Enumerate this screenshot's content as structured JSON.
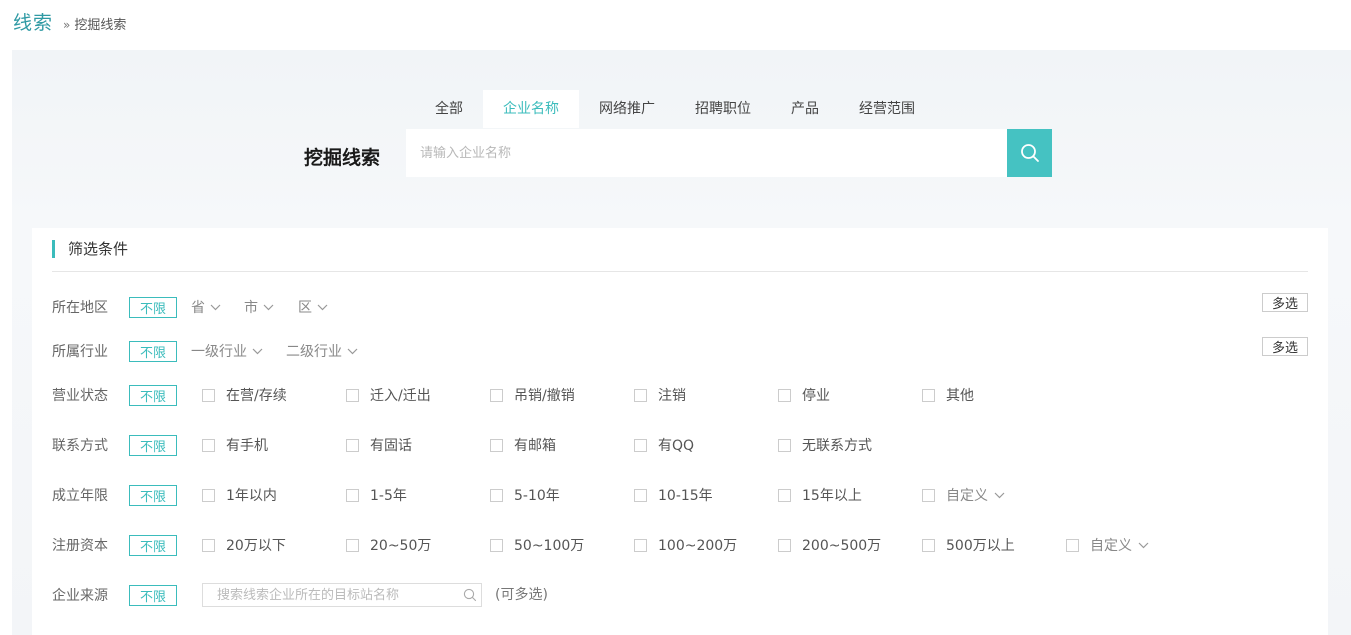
{
  "breadcrumb": {
    "root": "线索",
    "separator": "»",
    "current": "挖掘线索"
  },
  "search": {
    "tabs": [
      "全部",
      "企业名称",
      "网络推广",
      "招聘职位",
      "产品",
      "经营范围"
    ],
    "active_tab_index": 1,
    "label": "挖掘线索",
    "placeholder": "请输入企业名称",
    "value": "",
    "button_icon": "search-icon"
  },
  "filters": {
    "title": "筛选条件",
    "unlimited_label": "不限",
    "multi_select_label": "多选",
    "region": {
      "label": "所在地区",
      "dropdowns": [
        "省",
        "市",
        "区"
      ]
    },
    "industry": {
      "label": "所属行业",
      "dropdowns": [
        "一级行业",
        "二级行业"
      ]
    },
    "status": {
      "label": "营业状态",
      "options": [
        "在营/存续",
        "迁入/迁出",
        "吊销/撤销",
        "注销",
        "停业",
        "其他"
      ]
    },
    "contact": {
      "label": "联系方式",
      "options": [
        "有手机",
        "有固话",
        "有邮箱",
        "有QQ",
        "无联系方式"
      ]
    },
    "years": {
      "label": "成立年限",
      "options": [
        "1年以内",
        "1-5年",
        "5-10年",
        "10-15年",
        "15年以上"
      ],
      "custom": "自定义"
    },
    "capital": {
      "label": "注册资本",
      "options": [
        "20万以下",
        "20~50万",
        "50~100万",
        "100~200万",
        "200~500万",
        "500万以上"
      ],
      "custom": "自定义"
    },
    "source": {
      "label": "企业来源",
      "placeholder": "搜索线索企业所在的目标站名称",
      "value": "",
      "note": "(可多选)"
    }
  },
  "colors": {
    "accent": "#3bbcbc",
    "search_button": "#45c2c2",
    "breadcrumb": "#2f9aa4"
  }
}
